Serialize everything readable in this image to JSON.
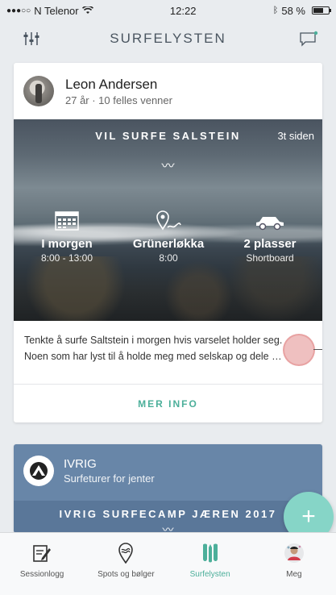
{
  "status_bar": {
    "carrier": "N Telenor",
    "signal_dots": "●●●○○",
    "time": "12:22",
    "battery": "58 %",
    "battery_level": 0.58
  },
  "navbar": {
    "title": "SURFELYSTEN"
  },
  "post": {
    "user_name": "Leon Andersen",
    "user_meta": "27 år  ·  10 felles venner",
    "title": "VIL SURFE SALSTEIN",
    "time_ago": "3t siden",
    "tilde": "〰",
    "details": [
      {
        "icon": "calendar-icon",
        "label": "I morgen",
        "sub": "8:00 - 13:00"
      },
      {
        "icon": "location-pin-icon",
        "label": "Grünerløkka",
        "sub": "8:00"
      },
      {
        "icon": "car-icon",
        "label": "2 plasser",
        "sub": "Shortboard"
      }
    ],
    "description_line1": "Tenkte å surfe Saltstein i morgen hvis varselet holder seg.",
    "description_line2": "Noen som har lyst til å holde meg med selskap og dele  …",
    "more_info": "MER INFO"
  },
  "camp": {
    "org_name": "IVRIG",
    "org_sub": "Surfeturer for jenter",
    "title": "IVRIG SURFECAMP JÆREN 2017",
    "tilde": "〰"
  },
  "fab": {
    "label": "+"
  },
  "tabs": [
    {
      "icon": "logbook-icon",
      "label": "Sessionlogg",
      "active": false
    },
    {
      "icon": "spots-icon",
      "label": "Spots og bølger",
      "active": false
    },
    {
      "icon": "surfelysten-icon",
      "label": "Surfelysten",
      "active": true
    },
    {
      "icon": "profile-icon",
      "label": "Meg",
      "active": false
    }
  ],
  "colors": {
    "accent": "#4caf9a",
    "fab": "#86d5c7",
    "camp_card": "#6886a8"
  }
}
